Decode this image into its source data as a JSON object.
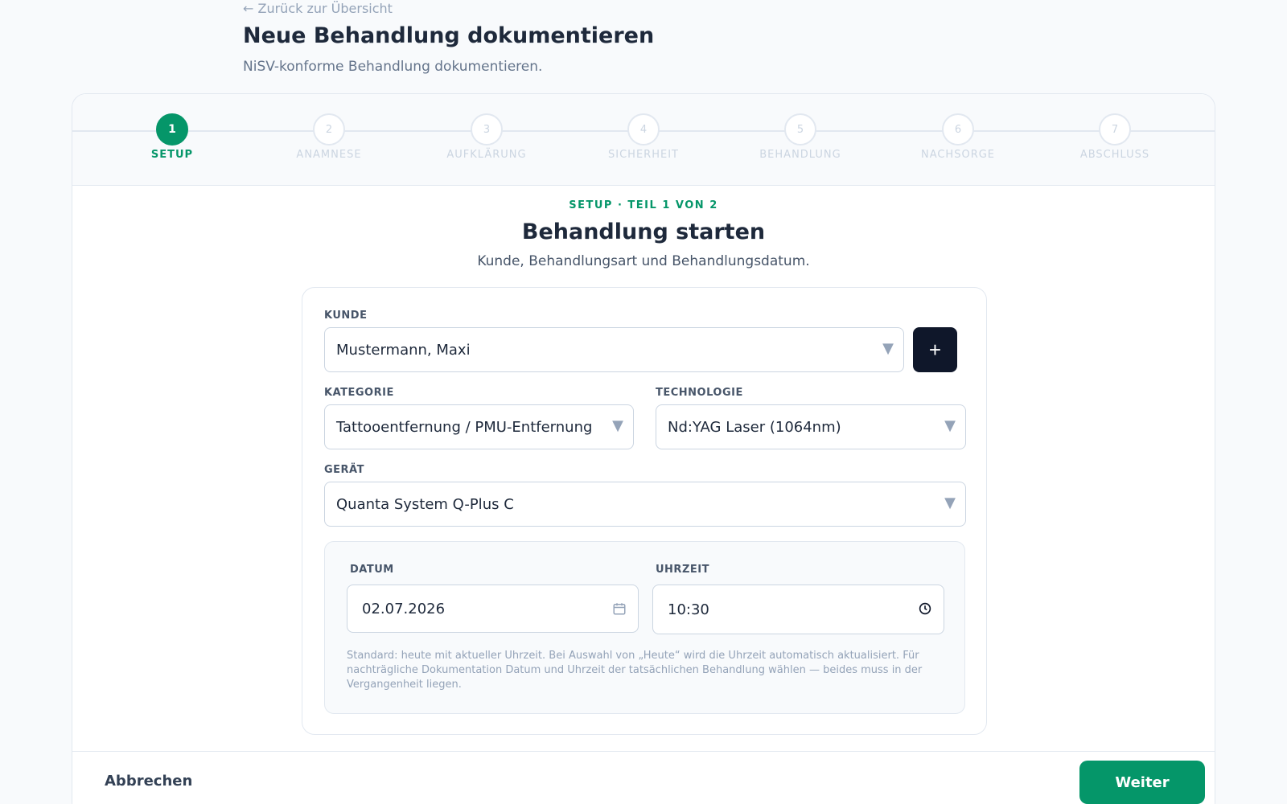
{
  "header": {
    "back_link": "← Zurück zur Übersicht",
    "title": "Neue Behandlung dokumentieren",
    "subtitle": "NiSV-konforme Behandlung dokumentieren."
  },
  "stepper": {
    "steps": [
      {
        "number": "1",
        "label": "SETUP",
        "active": true
      },
      {
        "number": "2",
        "label": "ANAMNESE",
        "active": false
      },
      {
        "number": "3",
        "label": "AUFKLÄRUNG",
        "active": false
      },
      {
        "number": "4",
        "label": "SICHERHEIT",
        "active": false
      },
      {
        "number": "5",
        "label": "BEHANDLUNG",
        "active": false
      },
      {
        "number": "6",
        "label": "NACHSORGE",
        "active": false
      },
      {
        "number": "7",
        "label": "ABSCHLUSS",
        "active": false
      }
    ]
  },
  "section": {
    "kicker": "SETUP · TEIL 1 VON 2",
    "title": "Behandlung starten",
    "subtitle": "Kunde, Behandlungsart und Behandlungsdatum."
  },
  "form": {
    "kunde": {
      "label": "KUNDE",
      "value": "Mustermann, Maxi",
      "add_label": "+"
    },
    "kategorie": {
      "label": "KATEGORIE",
      "value": "Tattooentfernung / PMU-Entfernung"
    },
    "technologie": {
      "label": "TECHNOLOGIE",
      "value": "Nd:YAG Laser (1064nm)"
    },
    "geraet": {
      "label": "GERÄT",
      "value": "Quanta System Q-Plus C"
    },
    "datum": {
      "label": "DATUM",
      "value": "02.07.2026"
    },
    "uhrzeit": {
      "label": "UHRZEIT",
      "value": "10:30"
    },
    "hint": "Standard: heute mit aktueller Uhrzeit. Bei Auswahl von „Heute“ wird die Uhrzeit automatisch aktualisiert. Für nachträgliche Dokumentation Datum und Uhrzeit der tatsächlichen Behandlung wählen — beides muss in der Vergangenheit liegen.",
    "caret_glyph": "▼"
  },
  "footer": {
    "cancel_label": "Abbrechen",
    "next_label": "Weiter"
  },
  "colors": {
    "accent": "#059669",
    "dark_button": "#0f172a",
    "muted": "#cbd5e1"
  },
  "icons": {
    "select_caret": "chevron-down-icon",
    "add": "plus-icon",
    "date": "calendar-icon",
    "time": "clock-icon"
  }
}
